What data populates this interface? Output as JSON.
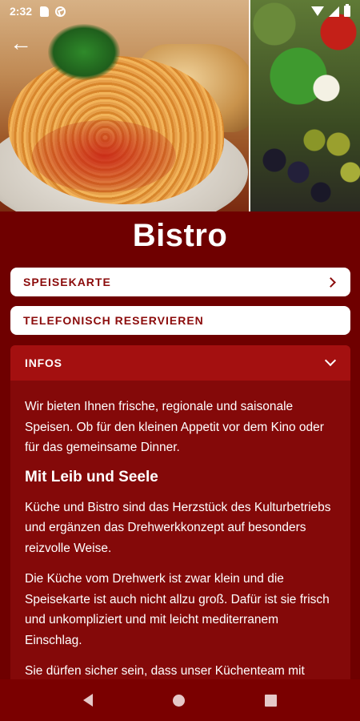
{
  "status_bar": {
    "time": "2:32",
    "icons": [
      "sd-card-icon",
      "sync-icon",
      "wifi-icon",
      "signal-icon",
      "battery-icon"
    ]
  },
  "header": {
    "back_icon": "arrow-left-icon",
    "back_glyph": "←",
    "title": "Bistro"
  },
  "actions": {
    "menu_label": "SPEISEKARTE",
    "menu_icon": "chevron-right-icon",
    "reserve_label": "TELEFONISCH RESERVIEREN"
  },
  "infos": {
    "header": "INFOS",
    "toggle_icon": "chevron-down-icon",
    "paragraphs": [
      "Wir bieten Ihnen frische, regionale und saisonale Speisen. Ob für den kleinen Appetit vor dem Kino oder für das gemeinsame Dinner.",
      "Küche und Bistro sind das Herzstück des Kulturbetriebs und ergänzen das Drehwerkkonzept auf besonders reizvolle Weise.",
      "Die Küche vom Drehwerk ist zwar klein und die Speisekarte ist auch nicht allzu groß. Dafür ist sie frisch und unkompliziert und mit leicht mediterranem Einschlag.",
      "Sie dürfen sicher sein, dass unser Küchenteam mit"
    ],
    "subheading": "Mit Leib und Seele"
  },
  "nav_bar": {
    "icons": [
      "nav-back-icon",
      "nav-home-icon",
      "nav-recent-apps-icon"
    ]
  },
  "colors": {
    "background": "#6f0000",
    "accordion_header": "#a41010",
    "accordion_body": "#840909",
    "button_text": "#8b0b0b",
    "button_background": "#ffffff"
  }
}
